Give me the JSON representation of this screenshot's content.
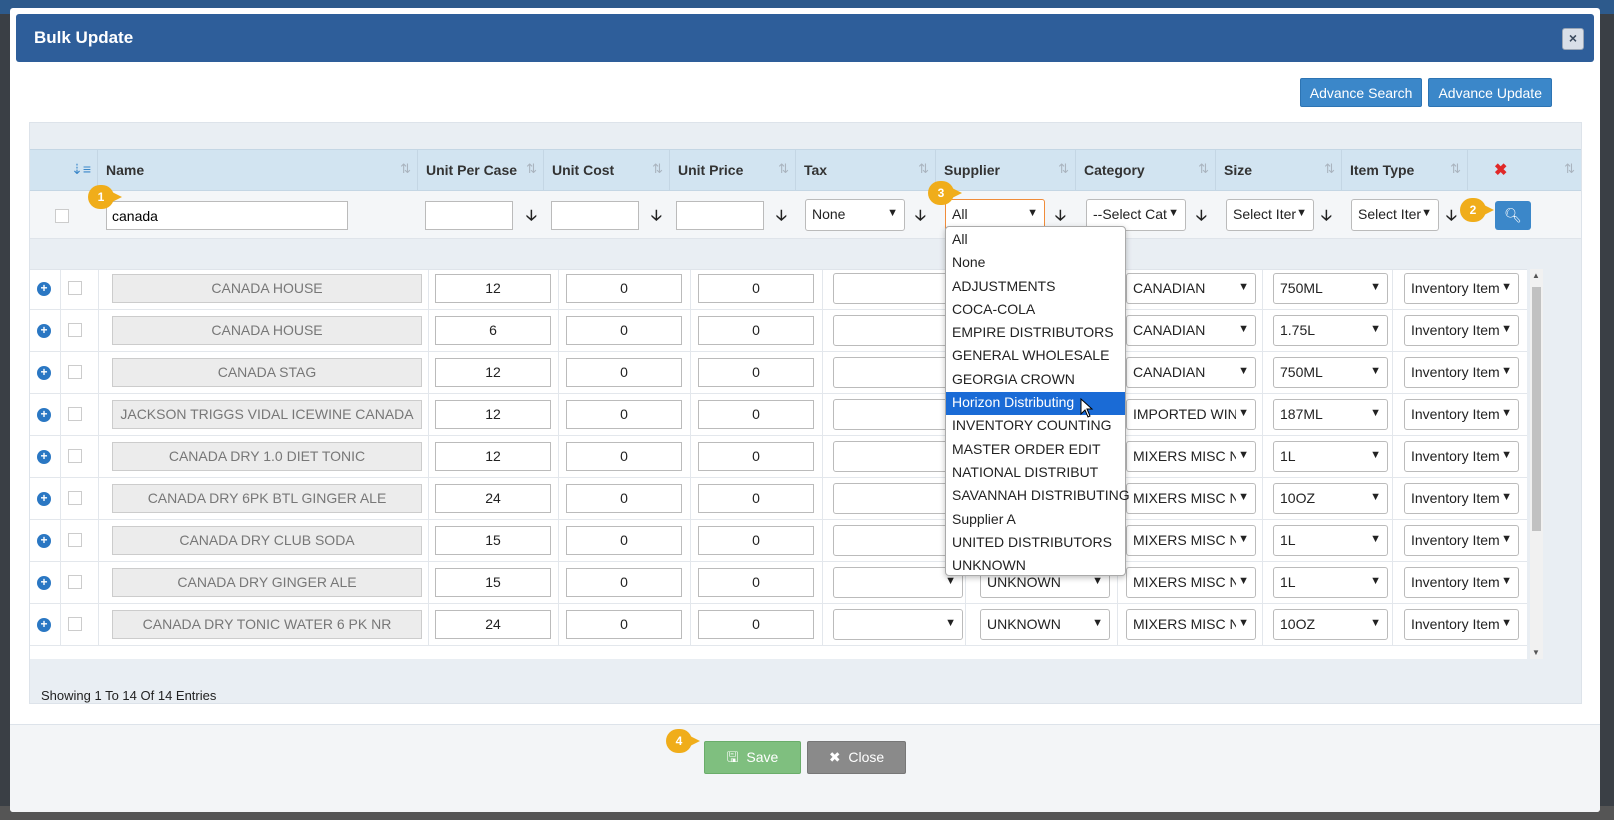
{
  "modal": {
    "title": "Bulk Update",
    "close_icon": "×"
  },
  "toolbar": {
    "advance_search": "Advance Search",
    "advance_update": "Advance Update"
  },
  "columns": {
    "name": "Name",
    "unit_per_case": "Unit Per Case",
    "unit_cost": "Unit Cost",
    "unit_price": "Unit Price",
    "tax": "Tax",
    "supplier": "Supplier",
    "category": "Category",
    "size": "Size",
    "item_type": "Item Type"
  },
  "filters": {
    "name_value": "canada",
    "tax": "None",
    "supplier": "All",
    "category": "--Select Cat",
    "size": "Select Iter",
    "item_type": "Select Iter"
  },
  "badges": {
    "b1": "1",
    "b2": "2",
    "b3": "3",
    "b4": "4"
  },
  "rows": [
    {
      "name": "CANADA HOUSE",
      "upc": "12",
      "cost": "0",
      "price": "0",
      "supplier": "",
      "category": "CANADIAN",
      "size": "750ML",
      "type": "Inventory Item"
    },
    {
      "name": "CANADA HOUSE",
      "upc": "6",
      "cost": "0",
      "price": "0",
      "supplier": "",
      "category": "CANADIAN",
      "size": "1.75L",
      "type": "Inventory Item"
    },
    {
      "name": "CANADA STAG",
      "upc": "12",
      "cost": "0",
      "price": "0",
      "supplier": "",
      "category": "CANADIAN",
      "size": "750ML",
      "type": "Inventory Item"
    },
    {
      "name": "JACKSON TRIGGS VIDAL ICEWINE CANADA",
      "upc": "12",
      "cost": "0",
      "price": "0",
      "supplier": "",
      "category": "IMPORTED WIN",
      "size": "187ML",
      "type": "Inventory Item"
    },
    {
      "name": "CANADA DRY 1.0 DIET TONIC",
      "upc": "12",
      "cost": "0",
      "price": "0",
      "supplier": "",
      "category": "MIXERS MISC N",
      "size": "1L",
      "type": "Inventory Item"
    },
    {
      "name": "CANADA DRY 6PK BTL GINGER ALE",
      "upc": "24",
      "cost": "0",
      "price": "0",
      "supplier": "",
      "category": "MIXERS MISC N",
      "size": "10OZ",
      "type": "Inventory Item"
    },
    {
      "name": "CANADA DRY CLUB SODA",
      "upc": "15",
      "cost": "0",
      "price": "0",
      "supplier": "",
      "category": "MIXERS MISC N",
      "size": "1L",
      "type": "Inventory Item"
    },
    {
      "name": "CANADA DRY GINGER ALE",
      "upc": "15",
      "cost": "0",
      "price": "0",
      "supplier": "UNKNOWN",
      "category": "MIXERS MISC N",
      "size": "1L",
      "type": "Inventory Item"
    },
    {
      "name": "CANADA DRY TONIC WATER 6 PK NR",
      "upc": "24",
      "cost": "0",
      "price": "0",
      "supplier": "UNKNOWN",
      "category": "MIXERS MISC N",
      "size": "10OZ",
      "type": "Inventory Item"
    }
  ],
  "supplier_options": [
    "All",
    "None",
    "ADJUSTMENTS",
    "COCA-COLA",
    "EMPIRE DISTRIBUTORS",
    "GENERAL WHOLESALE",
    "GEORGIA CROWN",
    "Horizon Distributing",
    "INVENTORY COUNTING",
    "MASTER ORDER EDIT",
    "NATIONAL DISTRIBUT",
    "SAVANNAH DISTRIBUTING",
    "Supplier A",
    "UNITED DISTRIBUTORS",
    "UNKNOWN"
  ],
  "supplier_highlighted": "Horizon Distributing",
  "status": {
    "showing": "Showing 1 To 14 Of 14 Entries"
  },
  "footer": {
    "save": "Save",
    "close": "Close"
  },
  "colors": {
    "header": "#2e5e9a",
    "accent": "#3b87c9",
    "badge": "#f0ad1a",
    "save": "#7fbf7f",
    "close": "#8a8a8a",
    "highlight": "#1a6bd6"
  }
}
